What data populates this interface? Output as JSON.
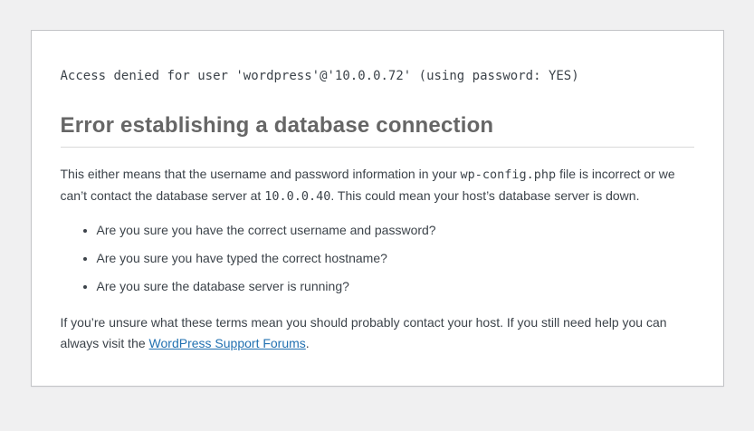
{
  "page": {
    "background_color": "#f0f0f1",
    "card_background_color": "#ffffff",
    "card_border_color": "#c3c4c7",
    "heading_color": "#666666",
    "text_color": "#3c434a",
    "link_color": "#2271b1",
    "divider_color": "#dadada"
  },
  "error_card": {
    "db_error_message": "Access denied for user 'wordpress'@'10.0.0.72' (using password: YES)",
    "heading": "Error establishing a database connection",
    "explanation": {
      "part1": "This either means that the username and password information in your ",
      "code_file": "wp-config.php",
      "part2": " file is incorrect or we can’t contact the database server at ",
      "code_host": "10.0.0.40",
      "part3": ". This could mean your host’s database server is down."
    },
    "checklist": [
      "Are you sure you have the correct username and password?",
      "Are you sure you have typed the correct hostname?",
      "Are you sure the database server is running?"
    ],
    "help": {
      "part1": "If you’re unsure what these terms mean you should probably contact your host. If you still need help you can always visit the ",
      "link_label": "WordPress Support Forums",
      "part2": "."
    }
  }
}
